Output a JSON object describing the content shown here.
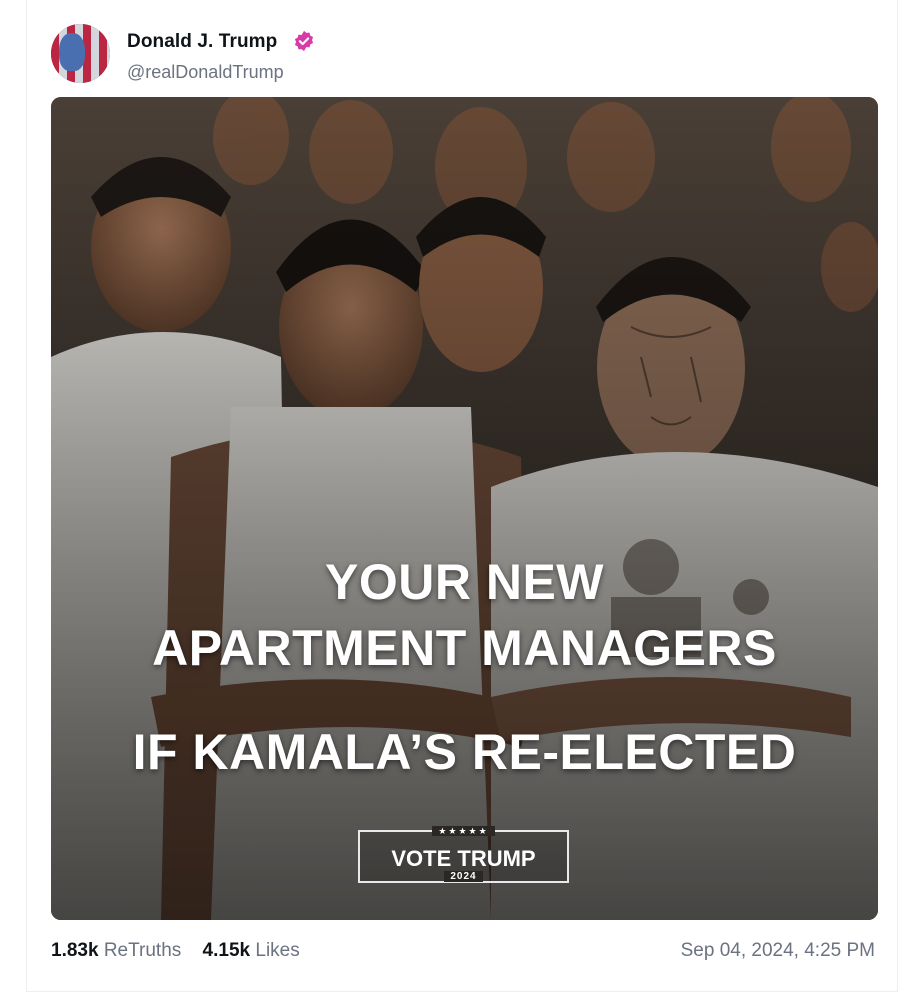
{
  "post": {
    "author_name": "Donald J. Trump",
    "author_handle": "@realDonaldTrump",
    "verified_icon": "verified-badge-icon",
    "accent_color": "#d63ba8",
    "image": {
      "headline_line1": "YOUR NEW",
      "headline_line2": "APARTMENT MANAGERS",
      "headline_line3": "IF KAMALA’S RE-ELECTED",
      "badge_stars": "★★★★★",
      "badge_text": "VOTE TRUMP",
      "badge_year": "2024"
    },
    "stats": {
      "retruths_count": "1.83k",
      "retruths_label": "ReTruths",
      "likes_count": "4.15k",
      "likes_label": "Likes"
    },
    "timestamp": "Sep 04, 2024, 4:25 PM"
  }
}
